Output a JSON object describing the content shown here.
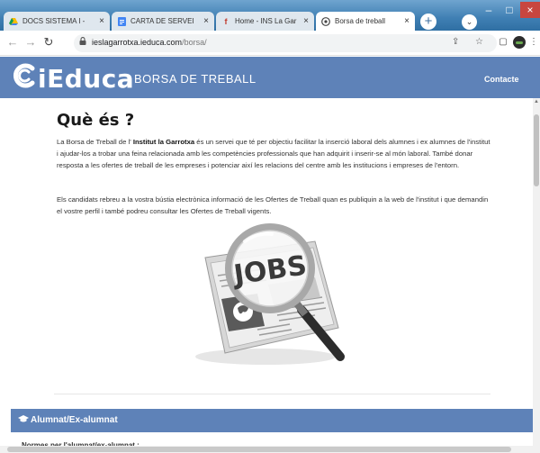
{
  "browser": {
    "tabs": [
      {
        "label": "DOCS SISTEMA I -",
        "icon": "google-drive-icon",
        "active": false
      },
      {
        "label": "CARTA DE SERVEI",
        "icon": "google-docs-icon",
        "active": false
      },
      {
        "label": "Home - INS La Gar",
        "icon": "site-favicon-icon",
        "active": false
      },
      {
        "label": "Borsa de treball",
        "icon": "globe-icon",
        "active": true
      }
    ],
    "close_glyph": "×",
    "url_host": "ieslagarrotxa.ieduca.com",
    "url_path": "/borsa/"
  },
  "site": {
    "logo_text": "iEduca",
    "subtitle": "BORSA DE TREBALL",
    "contact_link": "Contacte"
  },
  "main": {
    "heading": "Què és ?",
    "paragraph1_prefix": "La Borsa de Treball de l' ",
    "paragraph1_bold": "Institut la Garrotxa",
    "paragraph1_suffix": " és un servei que té per objectiu facilitar la inserció laboral dels alumnes i ex alumnes de l'institut i ajudar-los a trobar una feina relacionada amb les competències professionals que han adquirit i inserir-se al món laboral. També donar resposta a les ofertes de treball de les empreses i potenciar així les relacions del centre amb les institucions i empreses de l'entorn.",
    "paragraph2": "Els candidats rebreu a la vostra bústia electrònica informació de les Ofertes de Treball quan es publiquin a la web de l'institut i que demandin el vostre perfil i també podreu consultar les Ofertes de Treball vigents.",
    "illustration_word": "JOBS",
    "section_title": "Alumnat/Ex-alumnat",
    "cut_text": "Normes per l'alumnat/ex-alumnat :"
  },
  "colors": {
    "header_blue": "#5e82b8",
    "tab_bg": "#2f6fa3"
  }
}
